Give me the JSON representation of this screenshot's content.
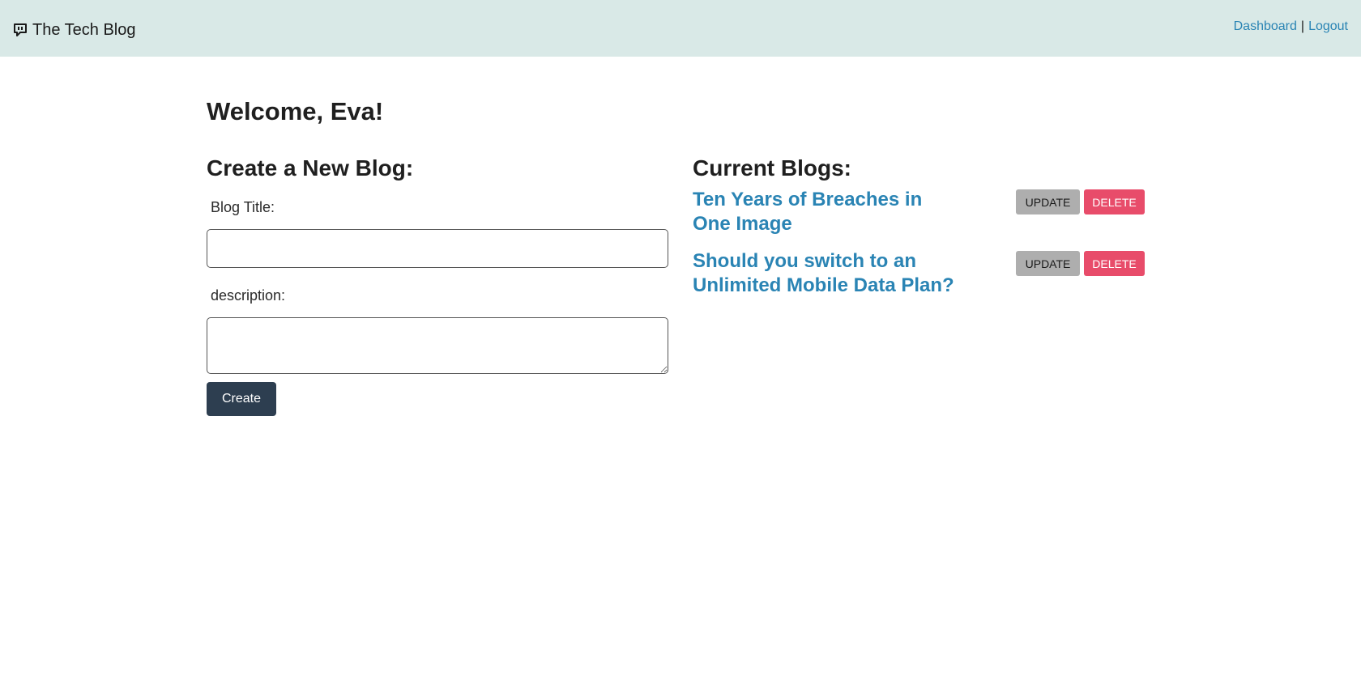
{
  "header": {
    "brand_icon": "chat-bubble-icon",
    "brand": "The Tech Blog",
    "nav": {
      "dashboard": "Dashboard",
      "separator": "|",
      "logout": "Logout"
    }
  },
  "main": {
    "welcome": "Welcome, Eva!",
    "create_form": {
      "title": "Create a New Blog:",
      "title_label": "Blog Title:",
      "title_value": "",
      "description_label": "description:",
      "description_value": "",
      "submit_label": "Create"
    },
    "current_blogs": {
      "title": "Current Blogs:",
      "items": [
        {
          "title": "Ten Years of Breaches in One Image",
          "update_label": "UPDATE",
          "delete_label": "DELETE"
        },
        {
          "title": "Should you switch to an Unlimited Mobile Data Plan?",
          "update_label": "UPDATE",
          "delete_label": "DELETE"
        }
      ]
    }
  },
  "colors": {
    "navbar_bg": "#d9e9e7",
    "link": "#2a84b4",
    "create_button": "#2d3e50",
    "update_button": "#aeaeae",
    "delete_button": "#e84c6a"
  }
}
